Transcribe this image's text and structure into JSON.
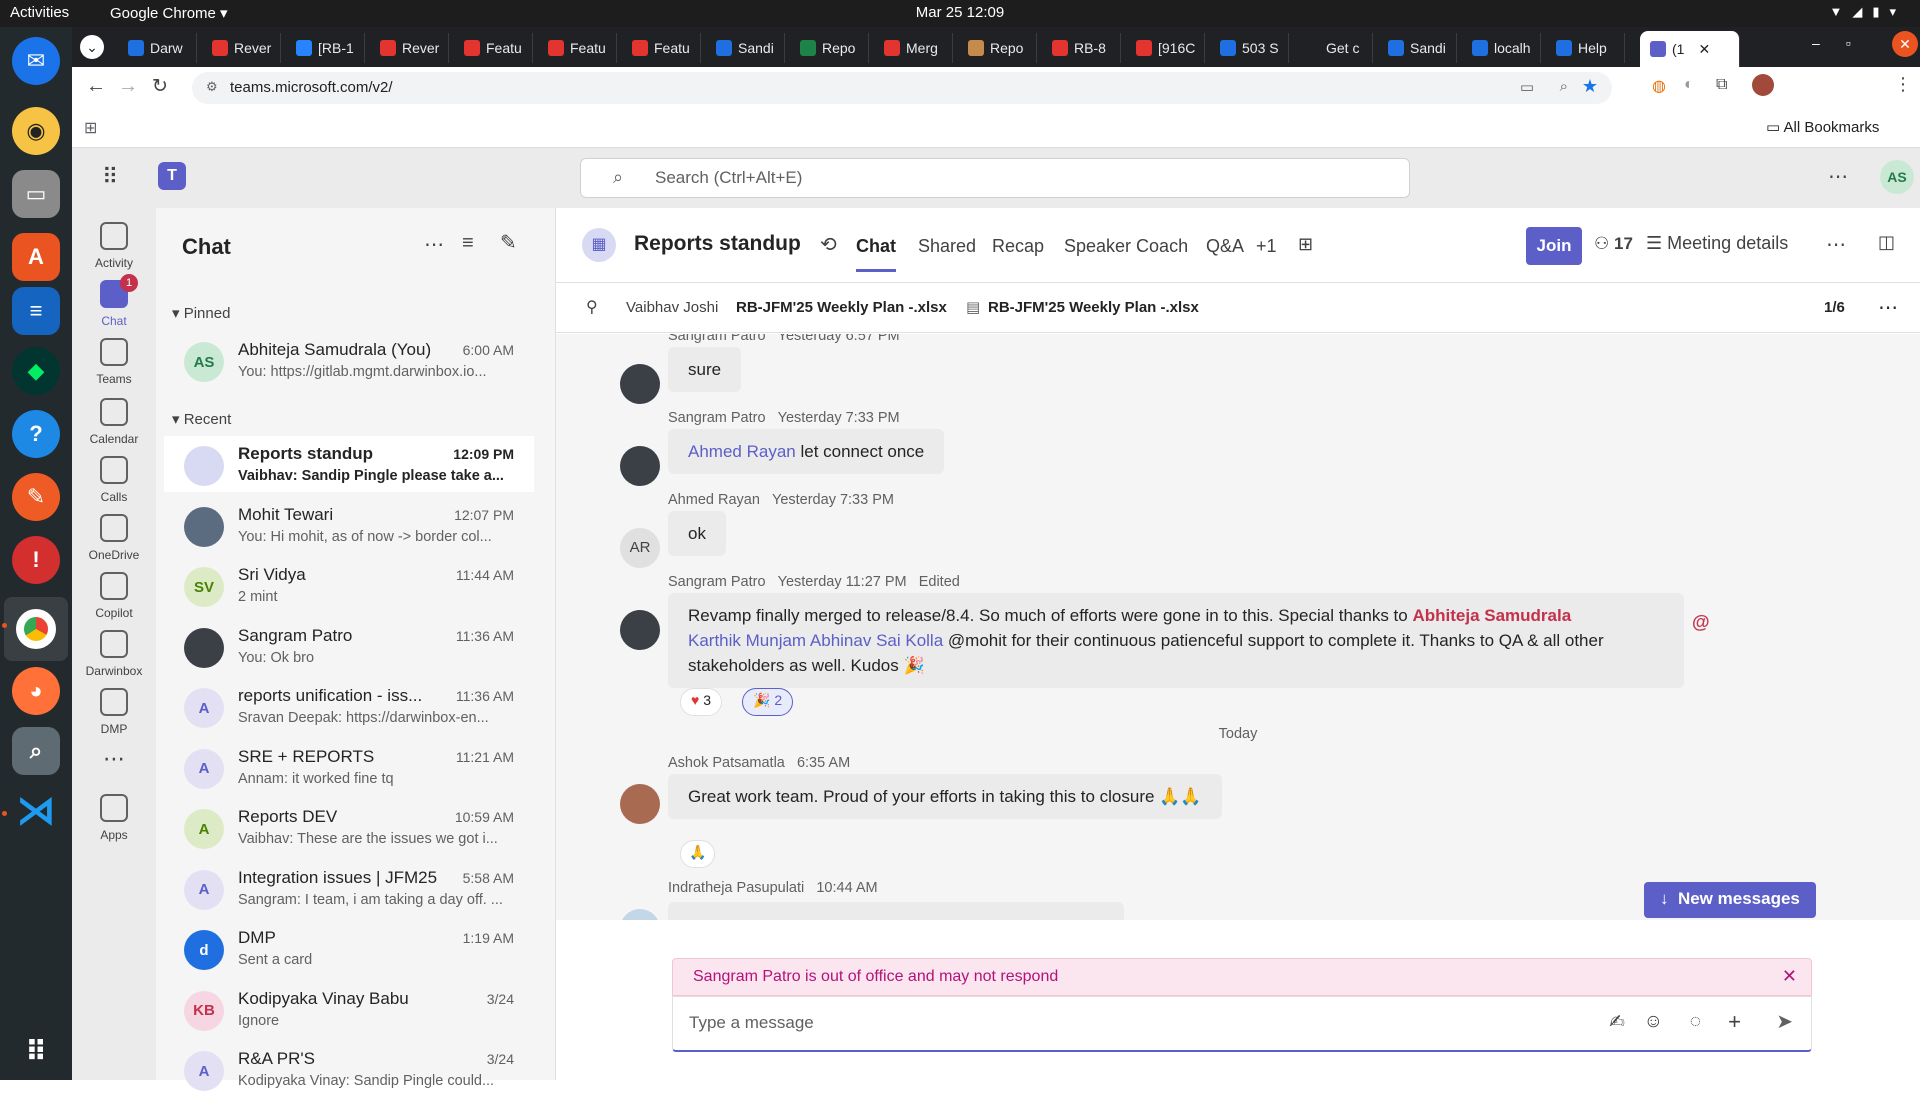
{
  "system": {
    "activities": "Activities",
    "app": "Google Chrome",
    "clock": "Mar 25  12:09"
  },
  "browser": {
    "tabs": [
      {
        "label": "Darw",
        "color": "#1f6fe0"
      },
      {
        "label": "Rever",
        "color": "#e3342f"
      },
      {
        "label": "[RB-1",
        "color": "#2684ff"
      },
      {
        "label": "Rever",
        "color": "#e3342f"
      },
      {
        "label": "Featu",
        "color": "#e3342f"
      },
      {
        "label": "Featu",
        "color": "#e3342f"
      },
      {
        "label": "Featu",
        "color": "#e3342f"
      },
      {
        "label": "Sandi",
        "color": "#1f6fe0"
      },
      {
        "label": "Repo",
        "color": "#1d8348"
      },
      {
        "label": "Merg",
        "color": "#e3342f"
      },
      {
        "label": "Repo",
        "color": "#c58b4d"
      },
      {
        "label": "RB-8",
        "color": "#e3342f"
      },
      {
        "label": "[916C",
        "color": "#e3342f"
      },
      {
        "label": "503 S",
        "color": "#1f6fe0"
      },
      {
        "label": "Get c",
        "color": "#202124"
      },
      {
        "label": "Sandi",
        "color": "#1f6fe0"
      },
      {
        "label": "localh",
        "color": "#1f6fe0"
      },
      {
        "label": "Help",
        "color": "#1f6fe0"
      }
    ],
    "active_tab": "(1",
    "url": "teams.microsoft.com/v2/",
    "bookmarks": "All Bookmarks"
  },
  "teams": {
    "search_placeholder": "Search (Ctrl+Alt+E)",
    "user_initials": "AS",
    "rail": [
      {
        "label": "Activity",
        "badge": ""
      },
      {
        "label": "Chat",
        "badge": "1"
      },
      {
        "label": "Teams",
        "badge": ""
      },
      {
        "label": "Calendar",
        "badge": ""
      },
      {
        "label": "Calls",
        "badge": ""
      },
      {
        "label": "OneDrive",
        "badge": ""
      },
      {
        "label": "Copilot",
        "badge": ""
      },
      {
        "label": "Darwinbox",
        "badge": ""
      },
      {
        "label": "DMP",
        "badge": ""
      },
      {
        "label": "Apps",
        "badge": ""
      }
    ],
    "chat_title": "Chat",
    "pinned_label": "Pinned",
    "recent_label": "Recent",
    "pinned": [
      {
        "name": "Abhiteja Samudrala (You)",
        "time": "6:00 AM",
        "preview": "You: https://gitlab.mgmt.darwinbox.io...",
        "initials": "AS",
        "color": "#c9e9d5",
        "fg": "#237b4b"
      }
    ],
    "recent": [
      {
        "name": "Reports standup",
        "time": "12:09 PM",
        "preview": "Vaibhav: Sandip Pingle please take a...",
        "initials": "",
        "color": "#d8d9f3",
        "fg": "#5b5fc7"
      },
      {
        "name": "Mohit Tewari",
        "time": "12:07 PM",
        "preview": "You: Hi mohit, as of now  -> border col...",
        "initials": "",
        "color": "#5b6b80",
        "fg": "#fff"
      },
      {
        "name": "Sri Vidya",
        "time": "11:44 AM",
        "preview": "2 mint",
        "initials": "SV",
        "color": "#dcebc6",
        "fg": "#498205"
      },
      {
        "name": "Sangram Patro",
        "time": "11:36 AM",
        "preview": "You: Ok bro",
        "initials": "",
        "color": "#3b3f46",
        "fg": "#fff"
      },
      {
        "name": "reports unification - iss...",
        "time": "11:36 AM",
        "preview": "Sravan Deepak: https://darwinbox-en...",
        "initials": "A",
        "color": "#e4e0f3",
        "fg": "#5b5fc7"
      },
      {
        "name": "SRE + REPORTS",
        "time": "11:21 AM",
        "preview": "Annam: it worked fine tq",
        "initials": "A",
        "color": "#e4e0f3",
        "fg": "#5b5fc7"
      },
      {
        "name": "Reports DEV",
        "time": "10:59 AM",
        "preview": "Vaibhav: These are the issues we got i...",
        "initials": "A",
        "color": "#dcebc6",
        "fg": "#498205"
      },
      {
        "name": "Integration issues | JFM25",
        "time": "5:58 AM",
        "preview": "Sangram: I team, i am taking a day off. ...",
        "initials": "A",
        "color": "#e4e0f3",
        "fg": "#5b5fc7"
      },
      {
        "name": "DMP",
        "time": "1:19 AM",
        "preview": "Sent a card",
        "initials": "d",
        "color": "#1f6fe0",
        "fg": "#fff"
      },
      {
        "name": "Kodipyaka Vinay Babu",
        "time": "3/24",
        "preview": "Ignore",
        "initials": "KB",
        "color": "#f6d6e2",
        "fg": "#c4314b"
      },
      {
        "name": "R&A PR'S",
        "time": "3/24",
        "preview": "Kodipyaka Vinay: Sandip Pingle could...",
        "initials": "A",
        "color": "#e4e0f3",
        "fg": "#5b5fc7"
      }
    ],
    "meeting": {
      "title": "Reports standup",
      "tabs": [
        "Chat",
        "Shared",
        "Recap",
        "Speaker Coach",
        "Q&A",
        "+1"
      ],
      "join": "Join",
      "participants": "17",
      "details": "Meeting details",
      "pin_author": "Vaibhav Joshi",
      "pin_text": "RB-JFM'25 Weekly Plan -.xlsx",
      "pin_text2": "RB-JFM'25 Weekly Plan -.xlsx",
      "pin_count": "1/6"
    },
    "messages": [
      {
        "sender": "Sangram Patro",
        "time": "Yesterday 6:57 PM",
        "text": "sure"
      },
      {
        "sender": "Sangram Patro",
        "time": "Yesterday 7:33 PM",
        "mention": "Ahmed Rayan",
        "text": " let connect once"
      },
      {
        "sender": "Ahmed Rayan",
        "time": "Yesterday 7:33 PM",
        "text": "ok",
        "initials": "AR"
      },
      {
        "sender": "Sangram Patro",
        "time": "Yesterday 11:27 PM",
        "edited": "Edited",
        "text_a": "Revamp finally merged to release/8.4. So much of efforts were gone in to this. Special thanks to ",
        "mention_me": "Abhiteja Samudrala",
        "mention2": "Karthik Munjam",
        "mention3": "Abhinav Sai Kolla",
        "text_b": " @mohit for their continuous patienceful support to complete it. Thanks to QA & all other stakeholders as well. Kudos 🎉",
        "reaction1": "3",
        "reaction2": "2"
      },
      {
        "sender": "Ashok Patsamatla",
        "time": "6:35 AM",
        "text": "Great work team. Proud of your efforts in taking this to closure 🙏🙏"
      },
      {
        "sender": "Indratheja Pasupulati",
        "time": "10:44 AM"
      }
    ],
    "today_label": "Today",
    "new_messages": "New messages",
    "ooo_notice": "Sangram Patro is out of office and may not respond",
    "compose_placeholder": "Type a message"
  }
}
